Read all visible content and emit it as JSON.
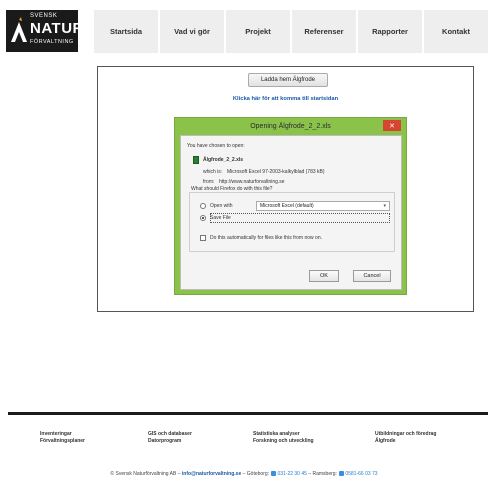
{
  "logo": {
    "line1": "SVENSK",
    "line2": "NATUR",
    "line3": "FÖRVALTNING"
  },
  "nav": [
    {
      "label": "Startsida"
    },
    {
      "label": "Vad vi gör"
    },
    {
      "label": "Projekt"
    },
    {
      "label": "Referenser"
    },
    {
      "label": "Rapporter"
    },
    {
      "label": "Kontakt"
    }
  ],
  "content": {
    "download_button": "Ladda hem Älgfrode",
    "back_link": "Klicka här för att komma till startsidan"
  },
  "dialog": {
    "title": "Opening Älgfrode_2_2.xls",
    "close_symbol": "✕",
    "chosen_label": "You have chosen to open:",
    "filename": "Älgfrode_2_2.xls",
    "which_is_label": "which is:",
    "which_is_value": "Microsoft Excel 97-2003-kalkylblad (783 kB)",
    "from_label": "from:",
    "from_value": "http://www.naturforvaltning.se",
    "question": "What should Firefox do with this file?",
    "open_with_label": "Open with",
    "open_with_value": "Microsoft Excel (default)",
    "save_file_label": "Save File",
    "auto_label": "Do this automatically for files like this from now on.",
    "ok_label": "OK",
    "cancel_label": "Cancel",
    "selected_option": "Save File"
  },
  "footer": {
    "columns": [
      {
        "line1": "Inventeringar",
        "line2": "Förvaltningsplaner"
      },
      {
        "line1": "GIS och databaser",
        "line2": "Datorprogram"
      },
      {
        "line1": "Statistiska analyser",
        "line2": "Forskning och utveckling"
      },
      {
        "line1": "Utbildningar och föredrag",
        "line2": "Älgfrode"
      }
    ],
    "copyright": "© Svensk Naturförvaltning AB",
    "sep1": "–",
    "email": "info@naturforvaltning.se",
    "sep2": "–",
    "city1": "Göteborg:",
    "phone1": "031-22 30 45",
    "sep3": "–",
    "city2": "Ramsberg:",
    "phone2": "0581-66 03 73"
  }
}
